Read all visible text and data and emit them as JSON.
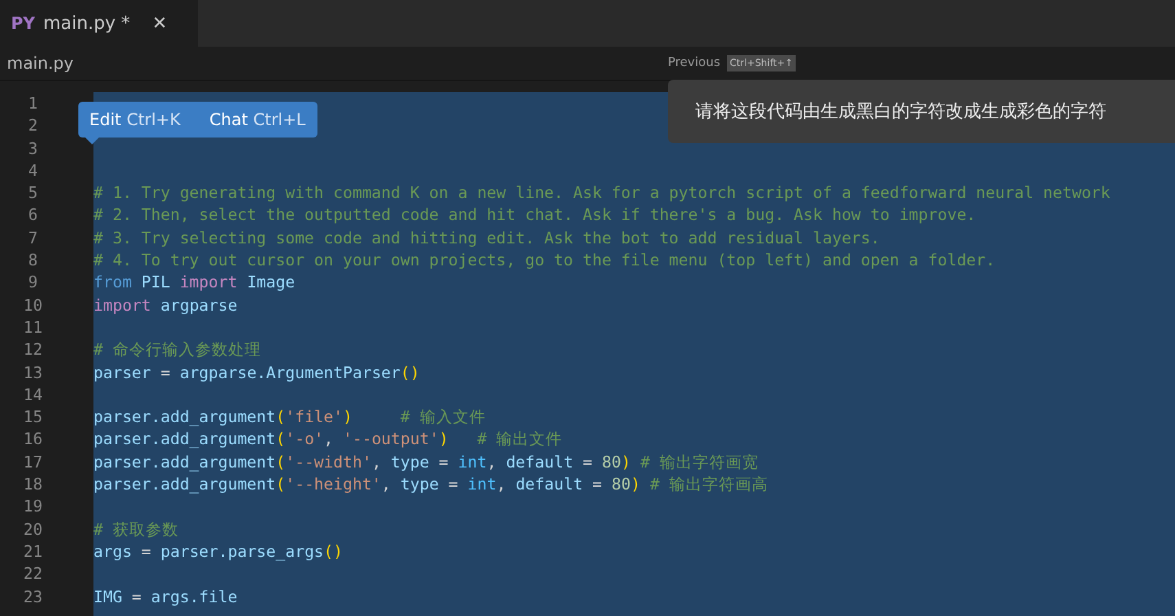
{
  "tab": {
    "icon_label": "PY",
    "title": "main.py *",
    "close": "✕",
    "selected": true
  },
  "breadcrumb": "main.py",
  "navigation": {
    "label": "Previous",
    "shortcut": "Ctrl+Shift+↑"
  },
  "prompt": "请将这段代码由生成黑白的字符改成生成彩色的字符",
  "inline_actions": [
    {
      "label": "Edit",
      "shortcut": "Ctrl+K"
    },
    {
      "label": "Chat",
      "shortcut": "Ctrl+L"
    }
  ],
  "lines": [
    {
      "number": "1",
      "selected": true
    },
    {
      "number": "2",
      "selected": true
    },
    {
      "number": "3",
      "selected": true
    },
    {
      "number": "4",
      "selected": true
    },
    {
      "number": "5",
      "selected": true,
      "tokens": [
        {
          "kind": "comment",
          "text": "# 1. Try generating with command K on a new line. Ask for a pytorch script of a feedforward neural network"
        }
      ]
    },
    {
      "number": "6",
      "selected": true,
      "tokens": [
        {
          "kind": "comment",
          "text": "# 2. Then, select the outputted code and hit chat. Ask if there's a bug. Ask how to improve."
        }
      ]
    },
    {
      "number": "7",
      "selected": true,
      "tokens": [
        {
          "kind": "comment",
          "text": "# 3. Try selecting some code and hitting edit. Ask the bot to add residual layers."
        }
      ]
    },
    {
      "number": "8",
      "selected": true,
      "tokens": [
        {
          "kind": "comment",
          "text": "# 4. To try out cursor on your own projects, go to the file menu (top left) and open a folder."
        }
      ]
    },
    {
      "number": "9",
      "selected": true,
      "tokens": [
        {
          "kind": "keyword",
          "text": "from "
        },
        {
          "kind": "name",
          "text": "PIL "
        },
        {
          "kind": "import",
          "text": "import "
        },
        {
          "kind": "name",
          "text": "Image"
        }
      ]
    },
    {
      "number": "10",
      "selected": true,
      "tokens": [
        {
          "kind": "import",
          "text": "import "
        },
        {
          "kind": "name",
          "text": "argparse"
        }
      ]
    },
    {
      "number": "11",
      "selected": true
    },
    {
      "number": "12",
      "selected": true,
      "tokens": [
        {
          "kind": "comment",
          "text": "# 命令行输入参数处理"
        }
      ]
    },
    {
      "number": "13",
      "selected": true,
      "tokens": [
        {
          "kind": "name",
          "text": "parser"
        },
        {
          "kind": "plain",
          "text": " = "
        },
        {
          "kind": "name",
          "text": "argparse.ArgumentParser"
        },
        {
          "kind": "paren",
          "text": "()"
        }
      ]
    },
    {
      "number": "14",
      "selected": true
    },
    {
      "number": "15",
      "selected": true,
      "tokens": [
        {
          "kind": "name",
          "text": "parser.add_argument"
        },
        {
          "kind": "paren",
          "text": "("
        },
        {
          "kind": "string",
          "text": "'file'"
        },
        {
          "kind": "paren",
          "text": ")     "
        },
        {
          "kind": "comment",
          "text": "# 输入文件"
        }
      ]
    },
    {
      "number": "16",
      "selected": true,
      "tokens": [
        {
          "kind": "name",
          "text": "parser.add_argument"
        },
        {
          "kind": "paren",
          "text": "("
        },
        {
          "kind": "string",
          "text": "'-o'"
        },
        {
          "kind": "plain",
          "text": ", "
        },
        {
          "kind": "string",
          "text": "'--output'"
        },
        {
          "kind": "paren",
          "text": ")   "
        },
        {
          "kind": "comment",
          "text": "# 输出文件"
        }
      ]
    },
    {
      "number": "17",
      "selected": true,
      "tokens": [
        {
          "kind": "name",
          "text": "parser.add_argument"
        },
        {
          "kind": "paren",
          "text": "("
        },
        {
          "kind": "string",
          "text": "'--width'"
        },
        {
          "kind": "plain",
          "text": ", "
        },
        {
          "kind": "name",
          "text": "type"
        },
        {
          "kind": "plain",
          "text": " = "
        },
        {
          "kind": "builtin",
          "text": "int"
        },
        {
          "kind": "plain",
          "text": ", "
        },
        {
          "kind": "name",
          "text": "default"
        },
        {
          "kind": "plain",
          "text": " = "
        },
        {
          "kind": "number",
          "text": "80"
        },
        {
          "kind": "paren",
          "text": ") "
        },
        {
          "kind": "comment",
          "text": "# 输出字符画宽"
        }
      ]
    },
    {
      "number": "18",
      "selected": true,
      "tokens": [
        {
          "kind": "name",
          "text": "parser.add_argument"
        },
        {
          "kind": "paren",
          "text": "("
        },
        {
          "kind": "string",
          "text": "'--height'"
        },
        {
          "kind": "plain",
          "text": ", "
        },
        {
          "kind": "name",
          "text": "type"
        },
        {
          "kind": "plain",
          "text": " = "
        },
        {
          "kind": "builtin",
          "text": "int"
        },
        {
          "kind": "plain",
          "text": ", "
        },
        {
          "kind": "name",
          "text": "default"
        },
        {
          "kind": "plain",
          "text": " = "
        },
        {
          "kind": "number",
          "text": "80"
        },
        {
          "kind": "paren",
          "text": ") "
        },
        {
          "kind": "comment",
          "text": "# 输出字符画高"
        }
      ]
    },
    {
      "number": "19",
      "selected": true
    },
    {
      "number": "20",
      "selected": true,
      "tokens": [
        {
          "kind": "comment",
          "text": "# 获取参数"
        }
      ]
    },
    {
      "number": "21",
      "selected": true,
      "tokens": [
        {
          "kind": "name",
          "text": "args"
        },
        {
          "kind": "plain",
          "text": " = "
        },
        {
          "kind": "name",
          "text": "parser.parse_args"
        },
        {
          "kind": "paren",
          "text": "()"
        }
      ]
    },
    {
      "number": "22",
      "selected": true
    },
    {
      "number": "23",
      "selected": true,
      "tokens": [
        {
          "kind": "name",
          "text": "IMG"
        },
        {
          "kind": "plain",
          "text": " = "
        },
        {
          "kind": "name",
          "text": "args.file"
        }
      ]
    }
  ]
}
